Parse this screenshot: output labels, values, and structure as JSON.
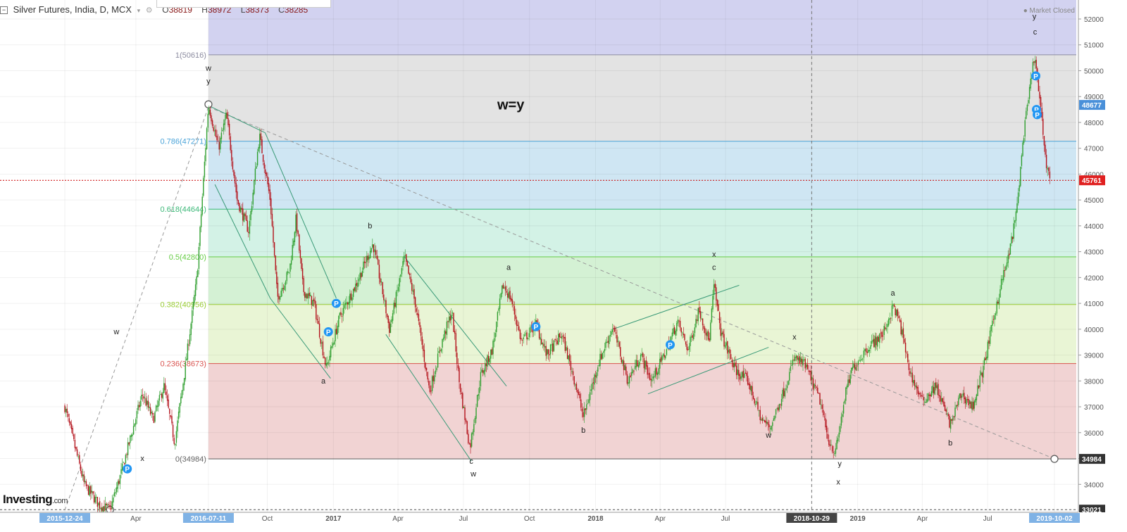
{
  "header": {
    "collapse_icon": "minus-square-icon",
    "symbol": "Silver Futures, India, D, MCX",
    "dropdown_icon": "chevron-down-icon",
    "open_label": "O",
    "open": "38819",
    "high_label": "H",
    "high": "38972",
    "low_label": "L",
    "low": "38373",
    "close_label": "C",
    "close": "38285"
  },
  "market_status": "● Market Closed",
  "logo": {
    "main": "Investing",
    "suffix": ".com"
  },
  "colors": {
    "bull": "#2e9e2e",
    "bear": "#b3121b",
    "fib_line": "#8c8ca0",
    "band_top": "#d2d2f0",
    "band_100_786": "#e3e3e3",
    "band_786_618": "#cfe6f3",
    "band_618_5": "#d3f2e6",
    "band_5_382": "#d4f1d4",
    "band_382_236": "#e9f5d5",
    "band_236_0": "#f1d3d3",
    "price_line": "#cc0000",
    "channel": "#3a9a78"
  },
  "chart_data": {
    "type": "candlestick",
    "title": "Silver Futures, India, D, MCX",
    "ylim": [
      32800,
      52400
    ],
    "y_ticks": [
      33000,
      34000,
      35000,
      36000,
      37000,
      38000,
      39000,
      40000,
      41000,
      42000,
      43000,
      44000,
      45000,
      46000,
      47000,
      48000,
      49000,
      50000,
      51000,
      52000
    ],
    "x_ticks": [
      {
        "label": "2015-12-24",
        "date": "2015-12-24",
        "highlight": true
      },
      {
        "label": "Apr",
        "date": "2016-04-01"
      },
      {
        "label": "2016-07-11",
        "date": "2016-07-11",
        "highlight": true
      },
      {
        "label": "Oct",
        "date": "2016-10-01"
      },
      {
        "label": "2017",
        "date": "2017-01-01",
        "bold": true
      },
      {
        "label": "Apr",
        "date": "2017-04-01"
      },
      {
        "label": "Jul",
        "date": "2017-07-01"
      },
      {
        "label": "Oct",
        "date": "2017-10-01"
      },
      {
        "label": "2018",
        "date": "2018-01-01",
        "bold": true
      },
      {
        "label": "Apr",
        "date": "2018-04-01"
      },
      {
        "label": "Jul",
        "date": "2018-07-01"
      },
      {
        "label": "2018-10-29",
        "date": "2018-10-29",
        "highlight": true,
        "dark": true
      },
      {
        "label": "2019",
        "date": "2019-01-01",
        "bold": true
      },
      {
        "label": "Apr",
        "date": "2019-04-01"
      },
      {
        "label": "Jul",
        "date": "2019-07-01"
      },
      {
        "label": "2019-10-02",
        "date": "2019-10-02",
        "highlight": true
      }
    ],
    "fibonacci": {
      "start_date": "2016-07-11",
      "levels": [
        {
          "label": "1(50616)",
          "value": 50616,
          "color": "#8c8ca0"
        },
        {
          "label": "0.786(47271)",
          "value": 47271,
          "color": "#4aa3d8"
        },
        {
          "label": "0.618(44644)",
          "value": 44644,
          "color": "#3cb878"
        },
        {
          "label": "0.5(42800)",
          "value": 42800,
          "color": "#66cc44"
        },
        {
          "label": "0.382(40956)",
          "value": 40956,
          "color": "#99cc33"
        },
        {
          "label": "0.236(38673)",
          "value": 38673,
          "color": "#d9534f"
        },
        {
          "label": "0(34984)",
          "value": 34984,
          "color": "#666666"
        }
      ]
    },
    "price_axis_labels": [
      {
        "text": "48677",
        "value": 48677,
        "bg": "#4a90d9"
      },
      {
        "text": "45761",
        "value": 45761,
        "bg": "#e02020"
      },
      {
        "text": "34984",
        "value": 34984,
        "bg": "#333333"
      },
      {
        "text": "33021",
        "value": 33021,
        "bg": "#333333"
      }
    ],
    "current_price": 45761,
    "low_line": 33021,
    "path": [
      [
        "2015-12-24",
        37000
      ],
      [
        "2016-01-20",
        34000
      ],
      [
        "2016-02-10",
        33200
      ],
      [
        "2016-02-25",
        33021
      ],
      [
        "2016-03-10",
        34300
      ],
      [
        "2016-04-10",
        37500
      ],
      [
        "2016-04-25",
        36500
      ],
      [
        "2016-05-10",
        37800
      ],
      [
        "2016-05-25",
        35600
      ],
      [
        "2016-06-10",
        38800
      ],
      [
        "2016-06-25",
        42000
      ],
      [
        "2016-07-11",
        48700
      ],
      [
        "2016-07-25",
        47000
      ],
      [
        "2016-08-05",
        48300
      ],
      [
        "2016-08-20",
        45000
      ],
      [
        "2016-09-05",
        43800
      ],
      [
        "2016-09-20",
        47500
      ],
      [
        "2016-10-05",
        45000
      ],
      [
        "2016-10-15",
        41200
      ],
      [
        "2016-11-01",
        42300
      ],
      [
        "2016-11-10",
        44300
      ],
      [
        "2016-11-20",
        41500
      ],
      [
        "2016-12-05",
        41000
      ],
      [
        "2016-12-22",
        38500
      ],
      [
        "2017-01-10",
        40500
      ],
      [
        "2017-02-01",
        41700
      ],
      [
        "2017-02-25",
        43300
      ],
      [
        "2017-03-10",
        41500
      ],
      [
        "2017-03-20",
        40000
      ],
      [
        "2017-04-10",
        42800
      ],
      [
        "2017-04-25",
        41000
      ],
      [
        "2017-05-15",
        37600
      ],
      [
        "2017-06-01",
        39500
      ],
      [
        "2017-06-15",
        40700
      ],
      [
        "2017-06-25",
        38000
      ],
      [
        "2017-07-10",
        35400
      ],
      [
        "2017-07-25",
        38200
      ],
      [
        "2017-08-10",
        39200
      ],
      [
        "2017-08-25",
        41700
      ],
      [
        "2017-09-05",
        41200
      ],
      [
        "2017-09-20",
        39500
      ],
      [
        "2017-10-10",
        40200
      ],
      [
        "2017-10-25",
        39000
      ],
      [
        "2017-11-15",
        39800
      ],
      [
        "2017-12-05",
        37800
      ],
      [
        "2017-12-15",
        36600
      ],
      [
        "2018-01-05",
        38700
      ],
      [
        "2018-01-25",
        40100
      ],
      [
        "2018-02-15",
        38000
      ],
      [
        "2018-03-05",
        39000
      ],
      [
        "2018-03-20",
        38000
      ],
      [
        "2018-04-10",
        39200
      ],
      [
        "2018-04-25",
        40300
      ],
      [
        "2018-05-10",
        39200
      ],
      [
        "2018-05-25",
        40800
      ],
      [
        "2018-06-08",
        39500
      ],
      [
        "2018-06-15",
        41700
      ],
      [
        "2018-06-25",
        39800
      ],
      [
        "2018-07-15",
        38400
      ],
      [
        "2018-08-01",
        38000
      ],
      [
        "2018-08-20",
        36500
      ],
      [
        "2018-09-01",
        36200
      ],
      [
        "2018-09-20",
        37600
      ],
      [
        "2018-10-05",
        38900
      ],
      [
        "2018-10-20",
        38600
      ],
      [
        "2018-11-10",
        37200
      ],
      [
        "2018-11-20",
        35800
      ],
      [
        "2018-12-01",
        35200
      ],
      [
        "2018-12-15",
        37500
      ],
      [
        "2018-12-25",
        38500
      ],
      [
        "2019-01-15",
        39300
      ],
      [
        "2019-02-05",
        39800
      ],
      [
        "2019-02-20",
        40900
      ],
      [
        "2019-03-01",
        40200
      ],
      [
        "2019-03-15",
        38300
      ],
      [
        "2019-04-01",
        37200
      ],
      [
        "2019-04-20",
        37800
      ],
      [
        "2019-05-10",
        36300
      ],
      [
        "2019-05-25",
        37500
      ],
      [
        "2019-06-10",
        37000
      ],
      [
        "2019-06-25",
        38500
      ],
      [
        "2019-07-10",
        40500
      ],
      [
        "2019-07-20",
        41800
      ],
      [
        "2019-07-30",
        42800
      ],
      [
        "2019-08-10",
        44500
      ],
      [
        "2019-08-20",
        47500
      ],
      [
        "2019-09-04",
        50600
      ],
      [
        "2019-09-12",
        48700
      ],
      [
        "2019-09-20",
        46500
      ],
      [
        "2019-09-27",
        45761
      ]
    ],
    "wave_labels": [
      {
        "text": "w",
        "date": "2016-07-11",
        "value": 50000
      },
      {
        "text": "y",
        "date": "2016-07-11",
        "value": 49500
      },
      {
        "text": "w",
        "date": "2016-03-05",
        "value": 39800
      },
      {
        "text": "x",
        "date": "2016-04-10",
        "value": 34900
      },
      {
        "text": "a",
        "date": "2016-12-18",
        "value": 37900
      },
      {
        "text": "b",
        "date": "2017-02-21",
        "value": 43900
      },
      {
        "text": "c",
        "date": "2017-07-12",
        "value": 34800
      },
      {
        "text": "w",
        "date": "2017-07-15",
        "value": 34300
      },
      {
        "text": "a",
        "date": "2017-09-02",
        "value": 42300
      },
      {
        "text": "b",
        "date": "2017-12-15",
        "value": 36000
      },
      {
        "text": "x",
        "date": "2018-06-15",
        "value": 42800
      },
      {
        "text": "c",
        "date": "2018-06-15",
        "value": 42300
      },
      {
        "text": "w",
        "date": "2018-08-30",
        "value": 35800
      },
      {
        "text": "x",
        "date": "2018-10-05",
        "value": 39600
      },
      {
        "text": "y",
        "date": "2018-12-07",
        "value": 34700
      },
      {
        "text": "x",
        "date": "2018-12-05",
        "value": 34000
      },
      {
        "text": "a",
        "date": "2019-02-19",
        "value": 41300
      },
      {
        "text": "b",
        "date": "2019-05-10",
        "value": 35500
      },
      {
        "text": "y",
        "date": "2019-09-04",
        "value": 52000
      },
      {
        "text": "c",
        "date": "2019-09-05",
        "value": 51400
      }
    ],
    "annotation": {
      "text": "w=y",
      "date": "2017-09-05",
      "value": 48500
    },
    "p_markers": [
      {
        "date": "2016-03-20",
        "value": 34600
      },
      {
        "date": "2016-12-25",
        "value": 39900
      },
      {
        "date": "2017-01-05",
        "value": 41000
      },
      {
        "date": "2017-10-10",
        "value": 40100
      },
      {
        "date": "2018-04-15",
        "value": 39400
      },
      {
        "date": "2019-09-06",
        "value": 49800
      },
      {
        "date": "2019-09-07",
        "value": 48500
      },
      {
        "date": "2019-09-08",
        "value": 48300
      }
    ],
    "trendlines": [
      {
        "from": [
          "2016-07-11",
          48600
        ],
        "to": [
          "2019-10-02",
          34984
        ],
        "style": "dashed"
      },
      {
        "from": [
          "2015-12-24",
          33000
        ],
        "to": [
          "2016-07-11",
          48600
        ],
        "style": "dashed"
      },
      {
        "from": [
          "2016-07-15",
          48600
        ],
        "to": [
          "2016-09-28",
          47600
        ],
        "style": "channel"
      },
      {
        "from": [
          "2016-09-28",
          47600
        ],
        "to": [
          "2017-01-05",
          41200
        ],
        "style": "channel"
      },
      {
        "from": [
          "2016-07-20",
          45600
        ],
        "to": [
          "2016-10-05",
          41200
        ],
        "style": "channel"
      },
      {
        "from": [
          "2016-10-05",
          41200
        ],
        "to": [
          "2016-12-28",
          38100
        ],
        "style": "channel"
      },
      {
        "from": [
          "2017-04-10",
          42800
        ],
        "to": [
          "2017-08-30",
          37800
        ],
        "style": "channel"
      },
      {
        "from": [
          "2017-03-15",
          39800
        ],
        "to": [
          "2017-07-12",
          34900
        ],
        "style": "channel"
      },
      {
        "from": [
          "2018-01-25",
          40000
        ],
        "to": [
          "2018-07-20",
          41700
        ],
        "style": "channel"
      },
      {
        "from": [
          "2018-03-15",
          37500
        ],
        "to": [
          "2018-08-30",
          39300
        ],
        "style": "channel"
      }
    ],
    "anchors": [
      {
        "date": "2016-07-11",
        "value": 48700
      },
      {
        "date": "2016-02-25",
        "value": 33021
      },
      {
        "date": "2019-10-02",
        "value": 34984
      }
    ],
    "crosshair": {
      "date": "2018-10-29"
    }
  }
}
